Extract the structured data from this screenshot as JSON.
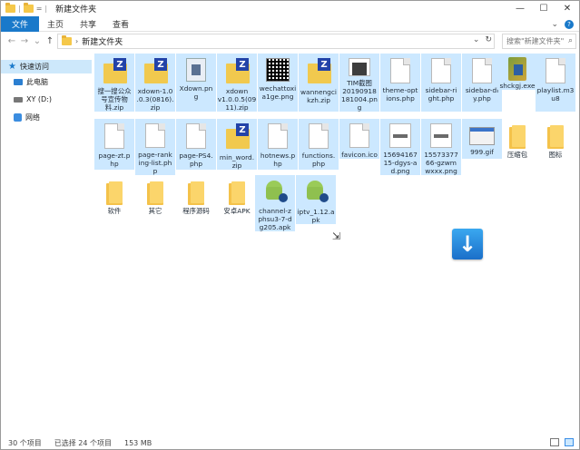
{
  "window": {
    "title": "新建文件夹",
    "quick_access_sep": "|",
    "quick_access_mini": "=",
    "controls": {
      "minimize": "—",
      "maximize": "☐",
      "close": "✕"
    }
  },
  "ribbon": {
    "tabs": [
      {
        "label": "文件",
        "active": true
      },
      {
        "label": "主页",
        "active": false
      },
      {
        "label": "共享",
        "active": false
      },
      {
        "label": "查看",
        "active": false
      }
    ],
    "expand": "⌄",
    "help": "?"
  },
  "address": {
    "back": "←",
    "forward": "→",
    "recent": "⌄",
    "up": "↑",
    "crumb_sep": "›",
    "path": "新建文件夹",
    "dropdown": "⌄",
    "refresh": "↻",
    "search_placeholder": "搜索\"新建文件夹\"",
    "search_icon": "⌕"
  },
  "navpane": {
    "items": [
      {
        "label": "快速访问",
        "icon": "star-icon",
        "selected": true
      },
      {
        "label": "此电脑",
        "icon": "pc-icon",
        "selected": false
      },
      {
        "label": "XY (D:)",
        "icon": "drive-icon",
        "selected": false
      },
      {
        "label": "网络",
        "icon": "network-icon",
        "selected": false
      }
    ]
  },
  "files": [
    {
      "name": "搜一搜公众\n号宣传物\n料.zip",
      "type": "zip",
      "selected": true
    },
    {
      "name": "xdown-1.0\n.0.3(0816).\nzip",
      "type": "zip",
      "selected": true
    },
    {
      "name": "Xdown.pn\ng",
      "type": "binary",
      "selected": true
    },
    {
      "name": "xdown\nv1.0.0.5(09\n11).zip",
      "type": "zip",
      "selected": true
    },
    {
      "name": "wechattoxi\na1ge.png",
      "type": "qr",
      "selected": true
    },
    {
      "name": "wannengci\nkzh.zip",
      "type": "zip",
      "selected": true
    },
    {
      "name": "TIM截图\n20190918\n181004.pn\ng",
      "type": "tim",
      "selected": true
    },
    {
      "name": "theme-opt\nions.php",
      "type": "doc",
      "selected": true
    },
    {
      "name": "sidebar-ri\nght.php",
      "type": "doc",
      "selected": true
    },
    {
      "name": "sidebar-di\ny.php",
      "type": "doc",
      "selected": true
    },
    {
      "name": "shckgj.exe",
      "type": "exe",
      "selected": true
    },
    {
      "name": "playlist.m3\nu8",
      "type": "doc",
      "selected": true
    },
    {
      "name": "page-zt.p\nhp",
      "type": "doc",
      "selected": true
    },
    {
      "name": "page-rank\ning-list.ph\np",
      "type": "doc",
      "selected": true
    },
    {
      "name": "page-PS4.\nphp",
      "type": "doc",
      "selected": true
    },
    {
      "name": "min_word.\nzip",
      "type": "zip",
      "selected": true
    },
    {
      "name": "hotnews.p\nhp",
      "type": "doc",
      "selected": true
    },
    {
      "name": "functions.\nphp",
      "type": "doc",
      "selected": true
    },
    {
      "name": "favicon.ico",
      "type": "doc",
      "selected": true
    },
    {
      "name": "15694167\n15-dgys-a\nd.png",
      "type": "img",
      "selected": true
    },
    {
      "name": "15573377\n66-gzwm\nwxxx.png",
      "type": "img",
      "selected": true
    },
    {
      "name": "999.gif",
      "type": "gif",
      "selected": true
    },
    {
      "name": "压缩包",
      "type": "folder",
      "selected": false
    },
    {
      "name": "图标",
      "type": "folder",
      "selected": false
    },
    {
      "name": "软件",
      "type": "folder",
      "selected": false
    },
    {
      "name": "其它",
      "type": "folder",
      "selected": false
    },
    {
      "name": "程序源码",
      "type": "folder",
      "selected": false
    },
    {
      "name": "安卓APK",
      "type": "folder",
      "selected": false
    },
    {
      "name": "channel-z\nphsu3-7-d\ng205.apk",
      "type": "apk",
      "selected": true
    },
    {
      "name": "iptv_1.12.a\npk",
      "type": "apk",
      "selected": true
    }
  ],
  "overlay": {
    "download_arrow": "↓",
    "cursor": "⇲"
  },
  "status": {
    "item_count": "30 个项目",
    "selected": "已选择 24 个项目",
    "size": "153 MB"
  }
}
